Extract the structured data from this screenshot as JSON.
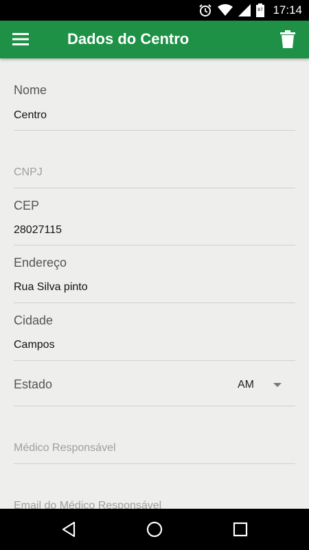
{
  "status_bar": {
    "time": "17:14",
    "battery_level": "87",
    "icons": [
      "alarm-icon",
      "wifi-icon",
      "signal-icon",
      "battery-icon"
    ]
  },
  "app_bar": {
    "title": "Dados do Centro",
    "color": "#1e9146",
    "icons": [
      "menu-icon",
      "trash-icon"
    ]
  },
  "form": {
    "nome": {
      "label": "Nome",
      "value": "Centro"
    },
    "cnpj": {
      "placeholder": "CNPJ"
    },
    "cep": {
      "label": "CEP",
      "value": "28027115"
    },
    "endereco": {
      "label": "Endereço",
      "value": "Rua Silva pinto"
    },
    "cidade": {
      "label": "Cidade",
      "value": "Campos"
    },
    "estado": {
      "label": "Estado",
      "selected": "AM"
    },
    "medico": {
      "placeholder": "Médico Responsável"
    },
    "email_medico": {
      "placeholder": "Email do Médico Responsável"
    }
  },
  "nav_bar": {
    "icons": [
      "back-icon",
      "home-icon",
      "recents-icon"
    ]
  }
}
